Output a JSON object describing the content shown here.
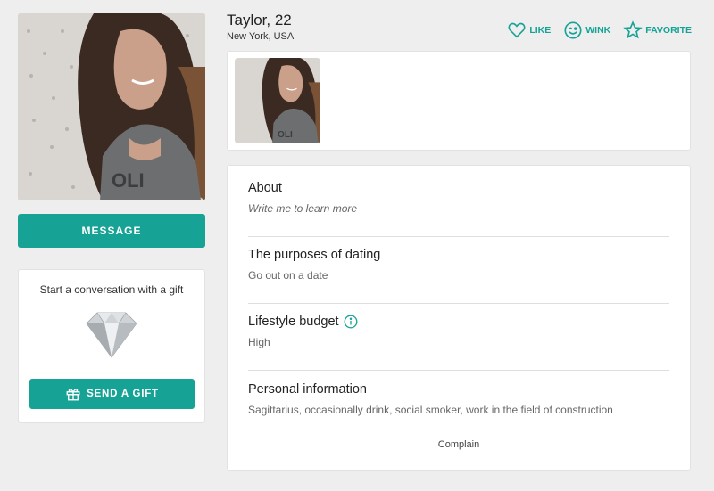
{
  "profile": {
    "name_age": "Taylor, 22",
    "location": "New York, USA"
  },
  "actions": {
    "like": "LIKE",
    "wink": "WINK",
    "favorite": "FAVORITE"
  },
  "sidebar": {
    "message_label": "MESSAGE",
    "gift_prompt": "Start a conversation with a gift",
    "send_gift_label": "SEND A GIFT"
  },
  "info": {
    "about": {
      "title": "About",
      "value": "Write me to learn more"
    },
    "purposes": {
      "title": "The purposes of dating",
      "value": "Go out on a date"
    },
    "lifestyle": {
      "title": "Lifestyle budget",
      "value": "High"
    },
    "personal": {
      "title": "Personal information",
      "value": "Sagittarius, occasionally drink, social smoker, work in the field of construction"
    }
  },
  "complain_label": "Complain",
  "colors": {
    "accent": "#16a395",
    "background": "#eeeeee"
  },
  "icons": [
    "heart-icon",
    "wink-smiley-icon",
    "star-icon",
    "gift-icon",
    "info-icon",
    "diamond-icon"
  ]
}
